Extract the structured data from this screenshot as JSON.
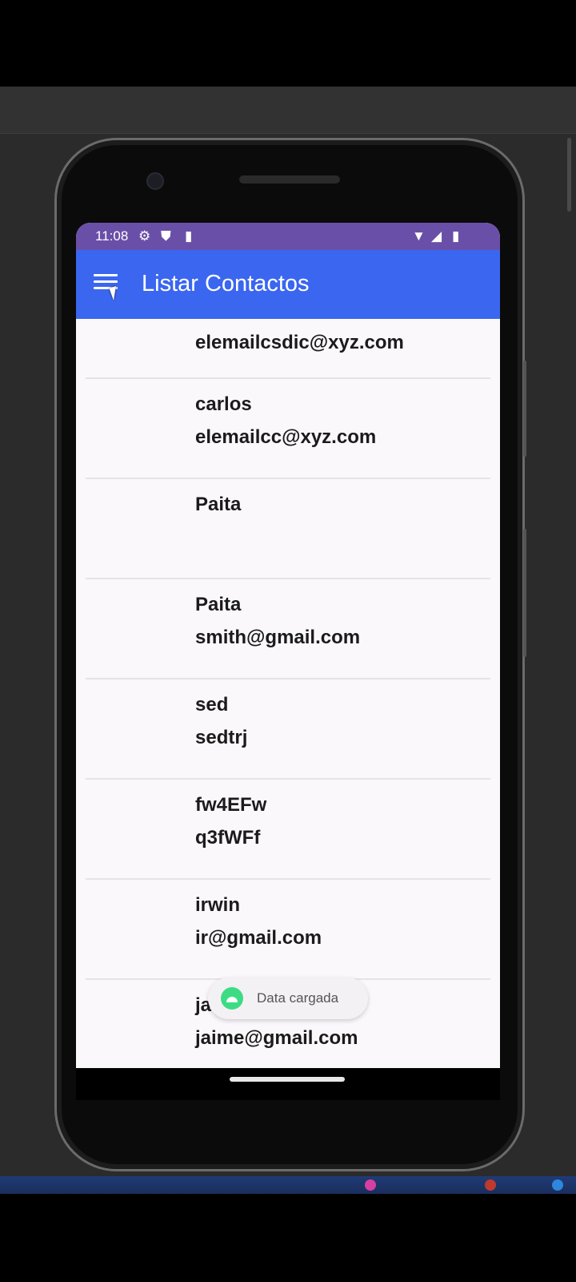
{
  "status_bar": {
    "time": "11:08",
    "left_icons": [
      "gear-icon",
      "shield-icon",
      "sd-card-icon"
    ],
    "right_icons": [
      "wifi-icon",
      "signal-icon",
      "battery-icon"
    ],
    "color": "#6a4fa8"
  },
  "app_bar": {
    "title": "Listar Contactos",
    "color": "#3a66f0"
  },
  "contacts": [
    {
      "name": "",
      "email": "elemailcsdic@xyz.com"
    },
    {
      "name": "carlos",
      "email": "elemailcc@xyz.com"
    },
    {
      "name": "Paita",
      "email": ""
    },
    {
      "name": "Paita",
      "email": "smith@gmail.com"
    },
    {
      "name": "sed",
      "email": "sedtrj"
    },
    {
      "name": "fw4EFw",
      "email": "q3fWFf"
    },
    {
      "name": "irwin",
      "email": "ir@gmail.com"
    },
    {
      "name": "ja",
      "email": "jaime@gmail.com"
    }
  ],
  "toast": {
    "message": "Data cargada"
  }
}
